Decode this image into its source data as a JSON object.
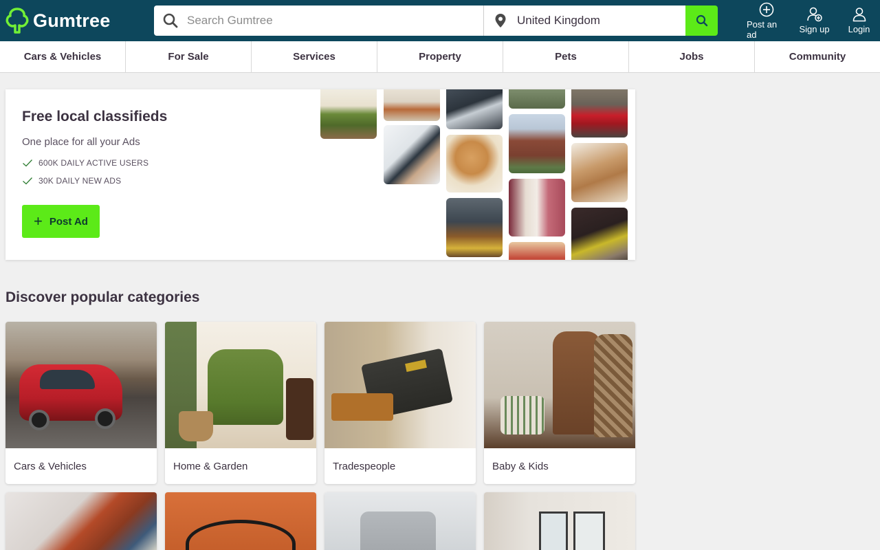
{
  "header": {
    "brand": "Gumtree",
    "search_placeholder": "Search Gumtree",
    "location": "United Kingdom",
    "actions": [
      {
        "label": "Post an ad",
        "icon": "plus-circle-icon"
      },
      {
        "label": "Sign up",
        "icon": "add-user-icon"
      },
      {
        "label": "Login",
        "icon": "user-icon"
      }
    ]
  },
  "nav": {
    "items": [
      "Cars & Vehicles",
      "For Sale",
      "Services",
      "Property",
      "Pets",
      "Jobs",
      "Community"
    ]
  },
  "hero": {
    "title": "Free local classifieds",
    "subtitle": "One place for all your Ads",
    "stats": [
      "600K DAILY ACTIVE USERS",
      "30K DAILY NEW ADS"
    ],
    "cta": "Post Ad"
  },
  "categories": {
    "title": "Discover popular categories",
    "items": [
      {
        "label": "Cars & Vehicles",
        "image": "red car on street"
      },
      {
        "label": "Home & Garden",
        "image": "green armchair"
      },
      {
        "label": "Tradespeople",
        "image": "tradesperson with toolbox"
      },
      {
        "label": "Baby & Kids",
        "image": "kids clothes and drum"
      }
    ]
  },
  "colors": {
    "header_bg": "#0d475c",
    "brand_green": "#5cea18",
    "logo_green": "#72ef36",
    "page_bg": "#f0f0f0",
    "text": "#3c3241"
  }
}
